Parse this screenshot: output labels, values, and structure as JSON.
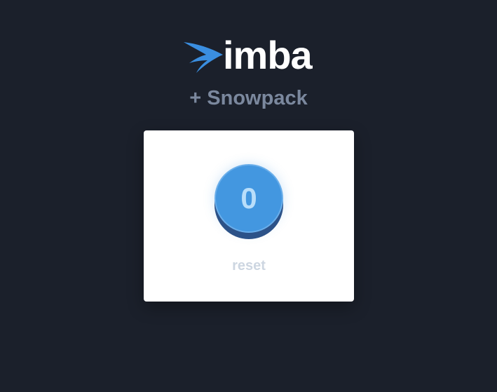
{
  "brand": {
    "name": "imba",
    "subtitle": "+ Snowpack",
    "accent": "#3a8ee0"
  },
  "counter": {
    "value": "0",
    "reset_label": "reset"
  }
}
